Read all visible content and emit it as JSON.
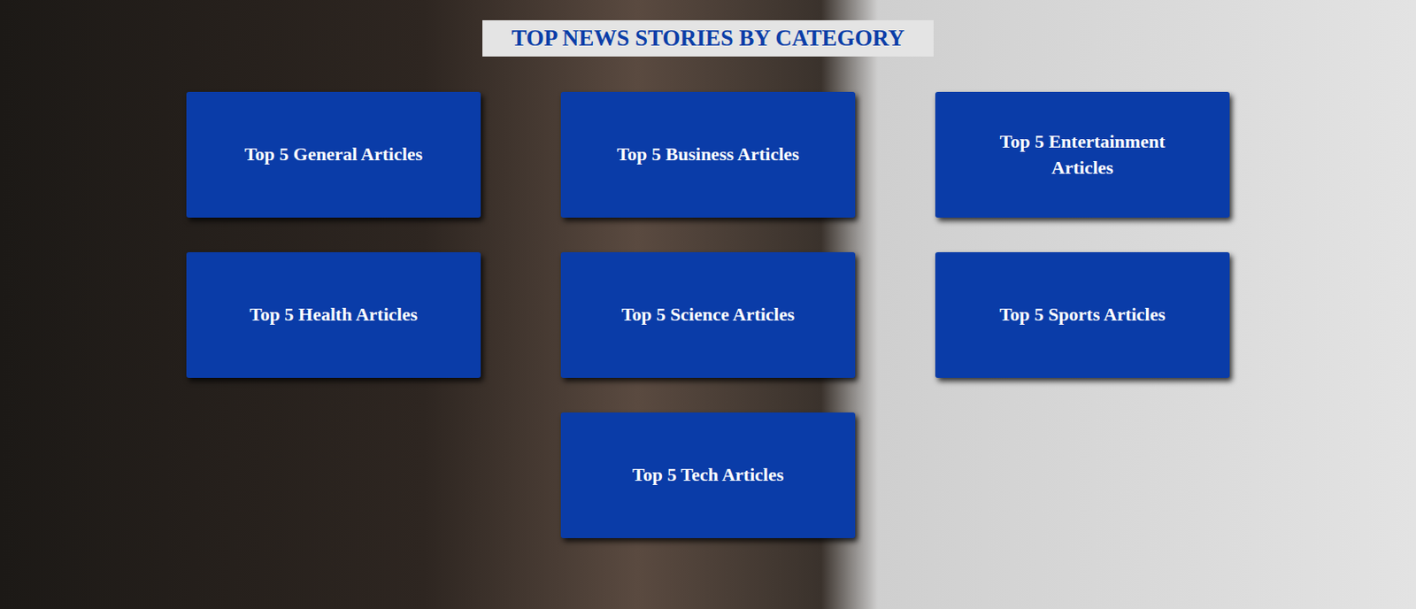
{
  "title": "TOP NEWS STORIES BY CATEGORY",
  "categories": [
    {
      "label": "Top 5 General Articles"
    },
    {
      "label": "Top 5 Business Articles"
    },
    {
      "label": "Top 5 Entertainment Articles"
    },
    {
      "label": "Top 5 Health Articles"
    },
    {
      "label": "Top 5 Science Articles"
    },
    {
      "label": "Top 5 Sports Articles"
    },
    {
      "label": "Top 5 Tech Articles"
    }
  ]
}
